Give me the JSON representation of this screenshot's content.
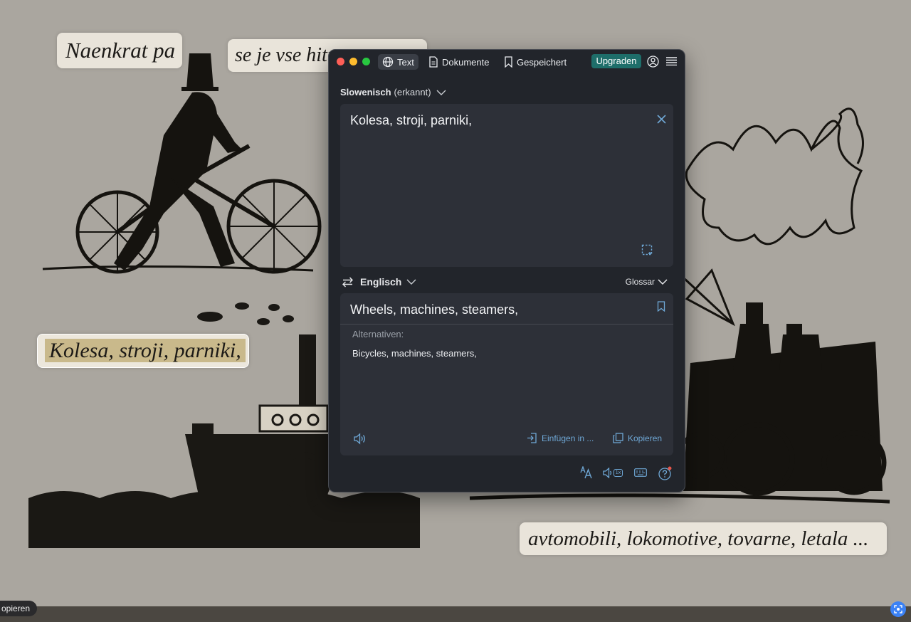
{
  "background": {
    "captions": [
      "Naenkrat pa",
      "se je vse hitro",
      "Kolesa, stroji, parniki,",
      "avtomobili, lokomotive, tovarne, letala ..."
    ],
    "kopieren_pill": "opieren"
  },
  "window": {
    "tabs": [
      {
        "label": "Text",
        "icon": "globe-icon"
      },
      {
        "label": "Dokumente",
        "icon": "document-icon"
      },
      {
        "label": "Gespeichert",
        "icon": "bookmark-icon"
      }
    ],
    "upgrade_label": "Upgraden",
    "source": {
      "language": "Slowenisch",
      "detected": "(erkannt)",
      "text": "Kolesa, stroji, parniki,"
    },
    "target": {
      "language": "Englisch",
      "glossary_label": "Glossar",
      "text": "Wheels, machines, steamers,",
      "alternatives_label": "Alternativen:",
      "alternative": "Bicycles, machines, steamers,",
      "insert_label": "Einfügen in ...",
      "copy_label": "Kopieren"
    },
    "footer": {
      "speed_badge": "1x"
    }
  },
  "colors": {
    "window_bg": "#22252b",
    "panel_bg": "#2d3038",
    "accent_blue": "#6fa8d6",
    "upgrade_green": "#1e6e6a"
  }
}
